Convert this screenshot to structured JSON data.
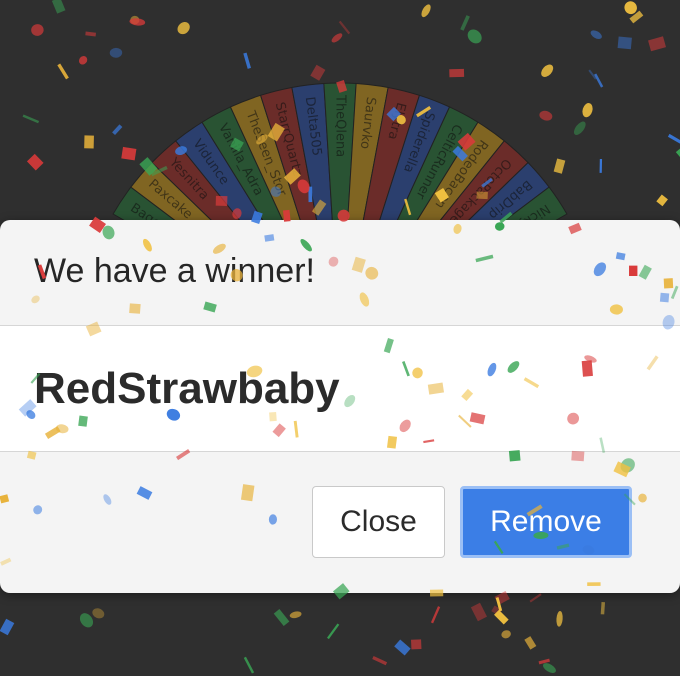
{
  "dialog": {
    "title": "We have a winner!",
    "winner": "RedStrawbaby",
    "buttons": {
      "close_label": "Close",
      "remove_label": "Remove"
    }
  },
  "wheel": {
    "entries": [
      "Bagel",
      "Paxcake",
      "Yesnitra",
      "Vidunce",
      "Vanilla_Adra",
      "TheSeen_Stor",
      "StarrQuartz",
      "Delta505",
      "TheQlena",
      "Saurvko",
      "Elytra",
      "Spiderella",
      "CelticRunner",
      "RodeoBacon",
      "OctoPackages",
      "BabDrip",
      "Nickyfan"
    ],
    "segment_colors": [
      "#2a6a3a",
      "#b0861f",
      "#8f2f2a",
      "#2d4c94",
      "#2a6a3a",
      "#b0861f",
      "#8f2f2a",
      "#2d4c94",
      "#2a6a3a",
      "#b0861f",
      "#8f2f2a",
      "#2d4c94",
      "#2a6a3a",
      "#b0861f",
      "#8f2f2a",
      "#2d4c94",
      "#2a6a3a"
    ]
  },
  "confetti_colors": [
    "#d93a3a",
    "#3a7be0",
    "#e8b23a",
    "#3aa655",
    "#f0c040"
  ]
}
